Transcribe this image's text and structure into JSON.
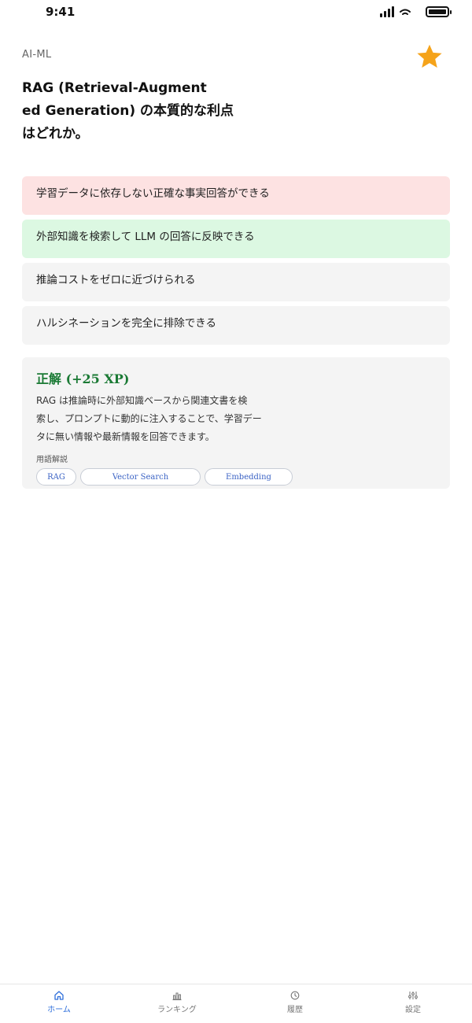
{
  "status": {
    "time": "9:41"
  },
  "header": {
    "category": "AI-ML",
    "favorite_icon": "star-icon",
    "favorite_color": "#f5a31a"
  },
  "question": {
    "lines": [
      "RAG (Retrieval-Augment",
      "ed Generation) の本質的な利点",
      "はどれか。"
    ]
  },
  "options": [
    {
      "label": "学習データに依存しない正確な事実回答ができる",
      "state": "wrong"
    },
    {
      "label": "外部知識を検索して LLM の回答に反映できる",
      "state": "correct"
    },
    {
      "label": "推論コストをゼロに近づけられる",
      "state": "neutral"
    },
    {
      "label": "ハルシネーションを完全に排除できる",
      "state": "neutral"
    }
  ],
  "explanation": {
    "title": "正解 (+25 XP)",
    "body_lines": [
      "RAG は推論時に外部知識ベースから関連文書を検",
      "索し、プロンプトに動的に注入することで、学習デー",
      "タに無い情報や最新情報を回答できます。"
    ],
    "terms_label": "用語解説",
    "terms": [
      "RAG",
      "Vector Search",
      "Embedding"
    ]
  },
  "tabs": [
    {
      "label": "ホーム",
      "icon": "home-icon",
      "active": true
    },
    {
      "label": "ランキング",
      "icon": "bar-chart-icon",
      "active": false
    },
    {
      "label": "履歴",
      "icon": "clock-icon",
      "active": false
    },
    {
      "label": "設定",
      "icon": "settings-icon",
      "active": false
    }
  ],
  "colors": {
    "accent": "#2f6fdb",
    "correct_bg": "#dcf8e2",
    "wrong_bg": "#fde2e2",
    "correct_text": "#1b7a35"
  }
}
